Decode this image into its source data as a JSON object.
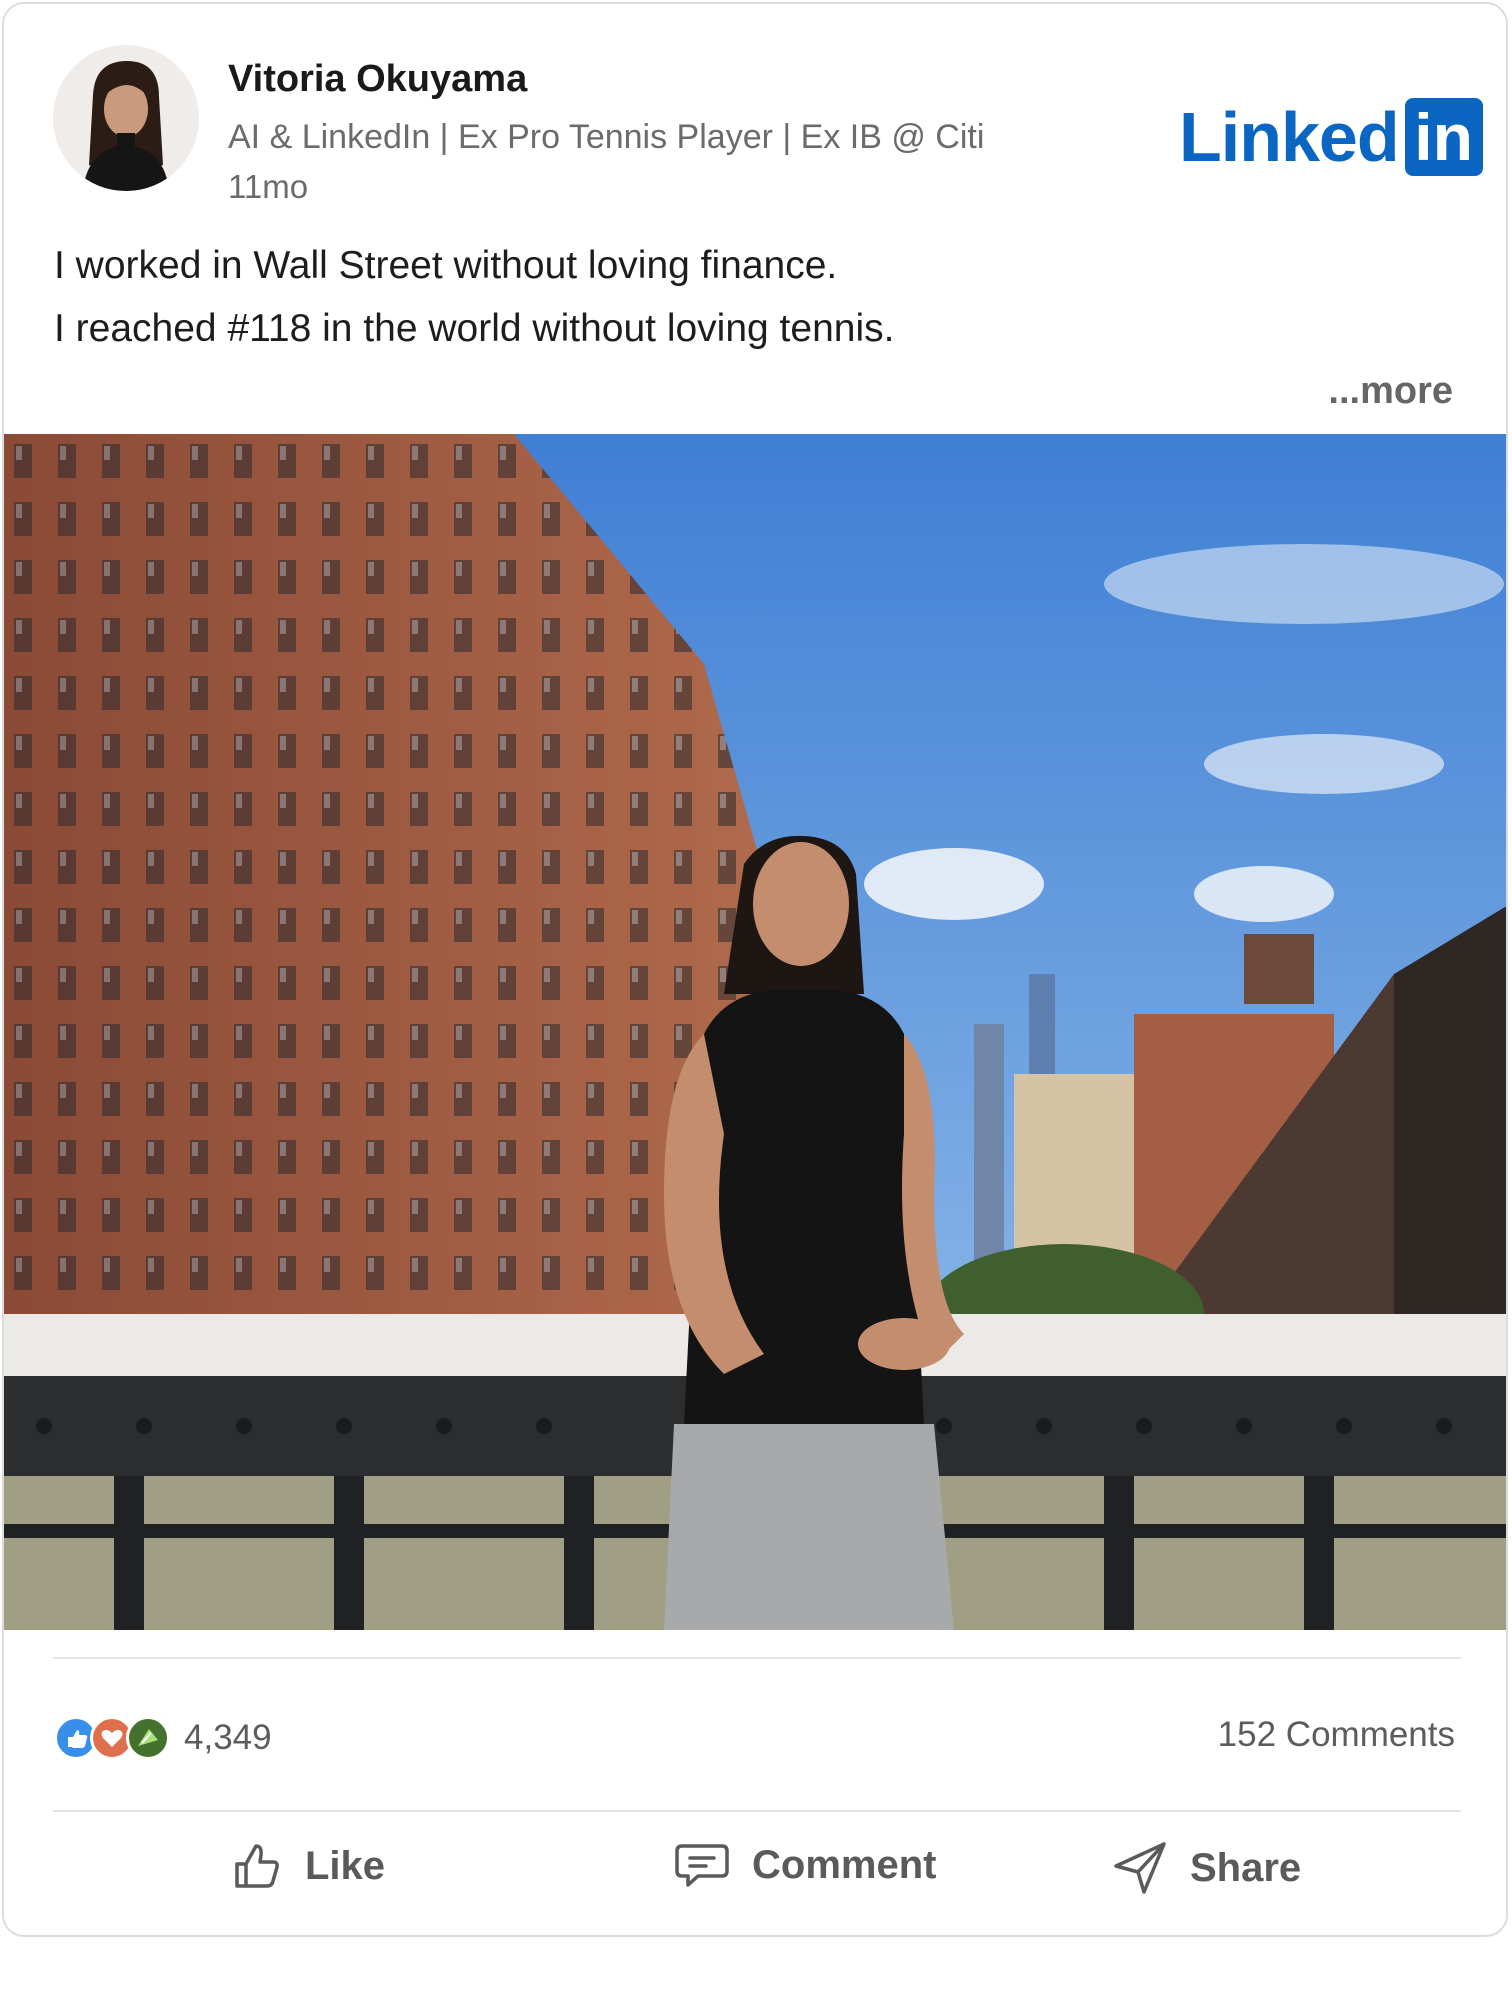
{
  "author": {
    "name": "Vitoria Okuyama",
    "headline": "AI & LinkedIn | Ex Pro Tennis Player | Ex IB @ Citi",
    "age": "11mo"
  },
  "brand": {
    "wordmark": "Linked",
    "box": "in",
    "color": "#0a66c2"
  },
  "post": {
    "lines": [
      "I worked in Wall Street without loving finance.",
      "I reached #118 in the world without loving tennis."
    ],
    "more_label": "...more"
  },
  "social": {
    "reaction_icons": [
      "like-icon",
      "love-icon",
      "celebrate-icon"
    ],
    "reaction_count": "4,349",
    "comments_label": "152 Comments"
  },
  "actions": {
    "like_label": "Like",
    "comment_label": "Comment",
    "share_label": "Share"
  }
}
